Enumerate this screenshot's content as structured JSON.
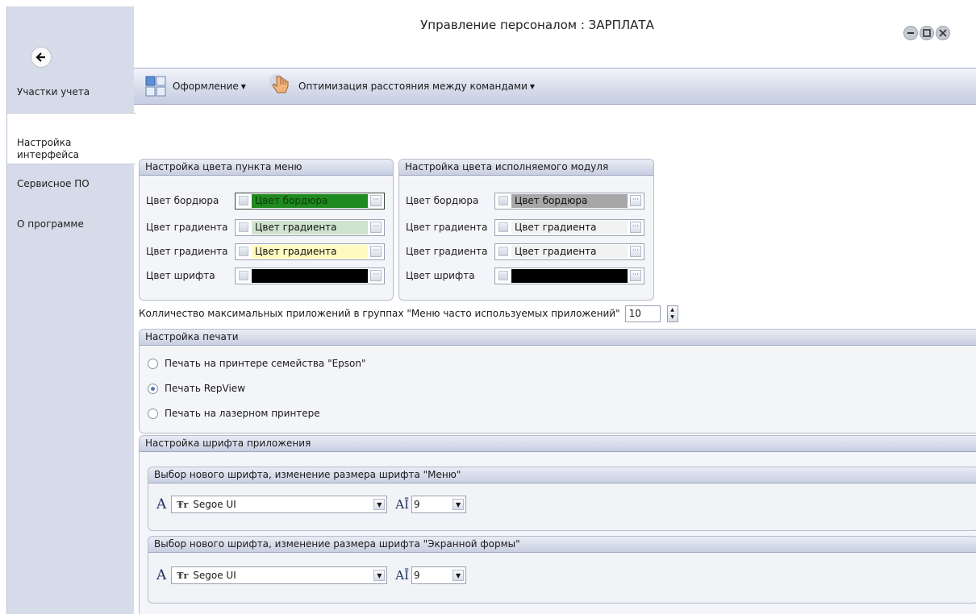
{
  "window": {
    "title": "Управление персоналом : ЗАРПЛАТА"
  },
  "nav": {
    "items": [
      {
        "label": "Участки учета"
      },
      {
        "label": "Настройка\nинтерфейса"
      },
      {
        "label": "Сервисное ПО"
      },
      {
        "label": "О программе"
      }
    ]
  },
  "toolbar": {
    "design_label": "Оформление",
    "spacing_label": "Оптимизация расстояния между командами"
  },
  "menu_colors": {
    "title": "Настройка цвета пункта меню",
    "rows": [
      {
        "label": "Цвет бордюра",
        "value": "Цвет бордюра",
        "color": "#1f8a1f",
        "text_color": "#0b3d0b"
      },
      {
        "label": "Цвет градиента",
        "value": "Цвет градиента",
        "color": "#cfe3cf",
        "text_color": "#111111"
      },
      {
        "label": "Цвет градиента",
        "value": "Цвет градиента",
        "color": "#fffbc0",
        "text_color": "#111111"
      },
      {
        "label": "Цвет шрифта",
        "value": "",
        "color": "#000000",
        "text_color": "#ffffff"
      }
    ]
  },
  "module_colors": {
    "title": "Настройка цвета исполняемого модуля",
    "rows": [
      {
        "label": "Цвет бордюра",
        "value": "Цвет бордюра",
        "color": "#a7a7a7",
        "text_color": "#111111"
      },
      {
        "label": "Цвет градиента",
        "value": "Цвет градиента",
        "color": "#f2f2f2",
        "text_color": "#111111"
      },
      {
        "label": "Цвет градиента",
        "value": "Цвет градиента",
        "color": "#f2f2f2",
        "text_color": "#111111"
      },
      {
        "label": "Цвет шрифта",
        "value": "",
        "color": "#000000",
        "text_color": "#ffffff"
      }
    ]
  },
  "max_apps": {
    "label": "Колличество максимальных приложений в группах \"Меню часто используемых приложений\"",
    "value": "10"
  },
  "print": {
    "title": "Настройка печати",
    "options": [
      {
        "label": "Печать на принтере семейства \"Epson\"",
        "selected": false
      },
      {
        "label": "Печать RepView",
        "selected": true
      },
      {
        "label": "Печать на лазерном принтере",
        "selected": false
      }
    ]
  },
  "fonts": {
    "title": "Настройка шрифта приложения",
    "menu": {
      "title": "Выбор нового шрифта, изменение размера шрифта \"Меню\"",
      "font": "Segoe UI",
      "size": "9"
    },
    "form": {
      "title": "Выбор нового шрифта, изменение размера шрифта \"Экранной формы\"",
      "font": "Segoe UI",
      "size": "9"
    }
  },
  "icons": {
    "back": "back-arrow-icon",
    "design": "layout-grid-icon",
    "spacing": "hand-pointer-icon",
    "font": "font-letter-icon",
    "font_family": "truetype-icon",
    "font_size": "font-size-icon"
  }
}
